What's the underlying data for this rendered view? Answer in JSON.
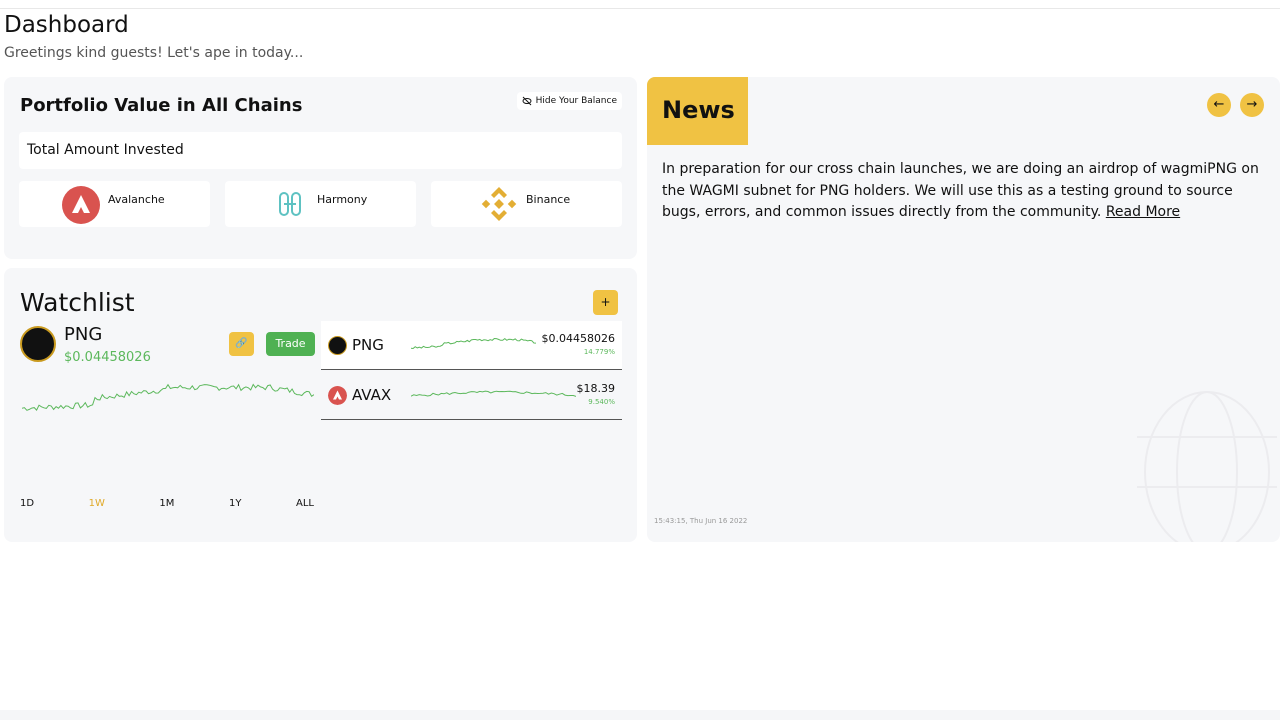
{
  "header": {
    "title": "Dashboard",
    "subtitle": "Greetings kind guests! Let's ape in today..."
  },
  "portfolio": {
    "title": "Portfolio Value in All Chains",
    "hide_label": "Hide Your Balance",
    "total_label": "Total Amount Invested",
    "chains": [
      {
        "name": "Avalanche",
        "icon": "avalanche-icon"
      },
      {
        "name": "Harmony",
        "icon": "harmony-icon"
      },
      {
        "name": "Binance",
        "icon": "binance-icon"
      }
    ]
  },
  "watchlist": {
    "title": "Watchlist",
    "add_label": "+",
    "selected": {
      "symbol": "PNG",
      "price": "$0.04458026"
    },
    "trade_label": "Trade",
    "ranges": [
      "1D",
      "1W",
      "1M",
      "1Y",
      "ALL"
    ],
    "active_range": "1W",
    "items": [
      {
        "symbol": "PNG",
        "price": "$0.04458026",
        "change": "14.779%"
      },
      {
        "symbol": "AVAX",
        "price": "$18.39",
        "change": "9.540%"
      }
    ]
  },
  "news": {
    "title": "News",
    "body": "In preparation for our cross chain launches, we are doing an airdrop of wagmiPNG on the WAGMI subnet for PNG holders. We will use this as a testing ground to source bugs, errors, and common issues directly from the community.",
    "read_more": "Read More",
    "timestamp": "15:43:15, Thu Jun 16 2022"
  },
  "colors": {
    "accent": "#f0c243",
    "positive": "#5cb85c",
    "trade": "#4fb153",
    "avalanche": "#d9534f"
  }
}
